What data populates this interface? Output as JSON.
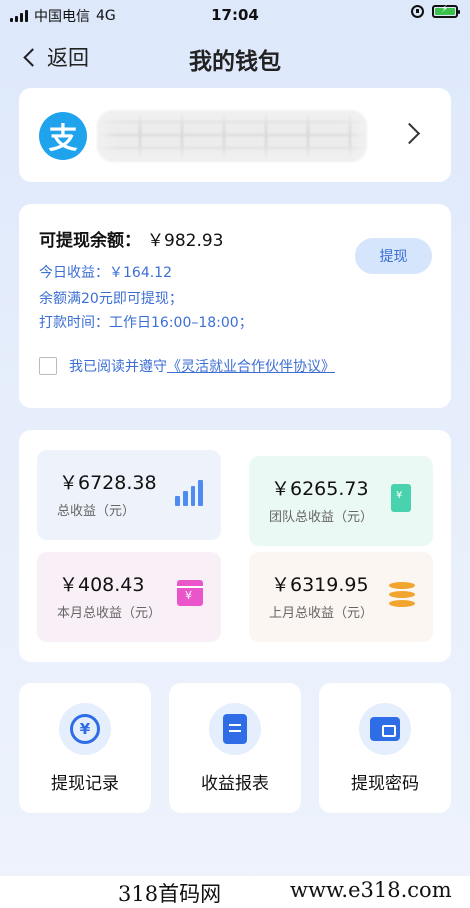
{
  "status_bar": {
    "carrier": "中国电信",
    "network": "4G",
    "time": "17:04"
  },
  "nav": {
    "back_label": "返回",
    "title": "我的钱包"
  },
  "account": {
    "icon_char": "支"
  },
  "balance": {
    "label": "可提现余额：",
    "amount": "￥982.93",
    "today_income": "今日收益：￥164.12",
    "min_note": "余额满20元即可提现；",
    "pay_time": "打款时间：工作日16:00–18:00；",
    "withdraw_label": "提现",
    "agree_prefix": "我已阅读并遵守",
    "agree_link": "《灵活就业合作伙伴协议》"
  },
  "stats": [
    {
      "value": "￥6728.38",
      "label": "总收益（元）"
    },
    {
      "value": "￥6265.73",
      "label": "团队总收益（元）"
    },
    {
      "value": "￥408.43",
      "label": "本月总收益（元）"
    },
    {
      "value": "￥6319.95",
      "label": "上月总收益（元）"
    }
  ],
  "actions": [
    {
      "label": "提现记录"
    },
    {
      "label": "收益报表"
    },
    {
      "label": "提现密码"
    }
  ],
  "watermark": {
    "left": "318首码网",
    "right": "www.e318.com"
  },
  "colors": {
    "accent": "#3c6fd4",
    "alipay": "#1fa3ec",
    "icon_blue": "#2f6de6"
  }
}
